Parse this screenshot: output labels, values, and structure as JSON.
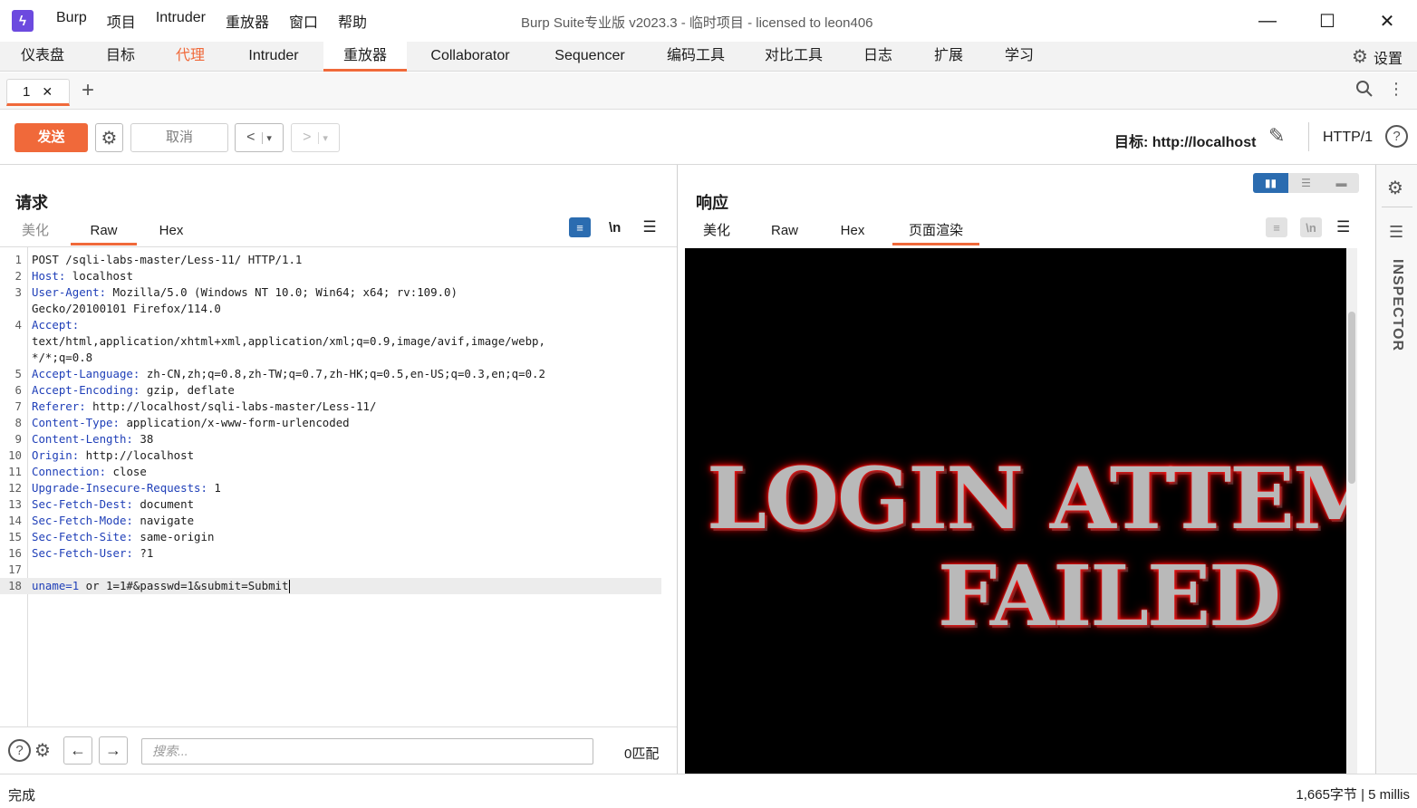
{
  "app": {
    "logo": "ϟ",
    "title": "Burp Suite专业版  v2023.3 - 临时项目 - licensed to leon406"
  },
  "menu": [
    "Burp",
    "项目",
    "Intruder",
    "重放器",
    "窗口",
    "帮助"
  ],
  "window_controls": [
    "—",
    "☐",
    "✕"
  ],
  "main_tabs": [
    "仪表盘",
    "目标",
    "代理",
    "Intruder",
    "重放器",
    "Collaborator",
    "Sequencer",
    "编码工具",
    "对比工具",
    "日志",
    "扩展",
    "学习"
  ],
  "settings_label": "设置",
  "sub_tab": {
    "label": "1",
    "close": "✕",
    "add": "+"
  },
  "toolbar": {
    "send": "发送",
    "cancel": "取消",
    "back": "<",
    "forward": ">",
    "dropdown": "▾",
    "target": "目标: http://localhost",
    "protocol": "HTTP/1",
    "help": "?"
  },
  "request": {
    "title": "请求",
    "tabs": [
      "美化",
      "Raw",
      "Hex"
    ],
    "wrap_label": "\\n",
    "menu_label": "☰",
    "lines": [
      {
        "n": "1",
        "key": "",
        "val": "POST /sqli-labs-master/Less-11/ HTTP/1.1"
      },
      {
        "n": "2",
        "key": "Host:",
        "val": " localhost"
      },
      {
        "n": "3",
        "key": "User-Agent:",
        "val": " Mozilla/5.0 (Windows NT 10.0; Win64; x64; rv:109.0)"
      },
      {
        "n": "",
        "key": "",
        "val": "Gecko/20100101 Firefox/114.0"
      },
      {
        "n": "4",
        "key": "Accept:",
        "val": ""
      },
      {
        "n": "",
        "key": "",
        "val": "text/html,application/xhtml+xml,application/xml;q=0.9,image/avif,image/webp,"
      },
      {
        "n": "",
        "key": "",
        "val": "*/*;q=0.8"
      },
      {
        "n": "5",
        "key": "Accept-Language:",
        "val": " zh-CN,zh;q=0.8,zh-TW;q=0.7,zh-HK;q=0.5,en-US;q=0.3,en;q=0.2"
      },
      {
        "n": "6",
        "key": "Accept-Encoding:",
        "val": " gzip, deflate"
      },
      {
        "n": "7",
        "key": "Referer:",
        "val": " http://localhost/sqli-labs-master/Less-11/"
      },
      {
        "n": "8",
        "key": "Content-Type:",
        "val": " application/x-www-form-urlencoded"
      },
      {
        "n": "9",
        "key": "Content-Length:",
        "val": " 38"
      },
      {
        "n": "10",
        "key": "Origin:",
        "val": " http://localhost"
      },
      {
        "n": "11",
        "key": "Connection:",
        "val": " close"
      },
      {
        "n": "12",
        "key": "Upgrade-Insecure-Requests:",
        "val": " 1"
      },
      {
        "n": "13",
        "key": "Sec-Fetch-Dest:",
        "val": " document"
      },
      {
        "n": "14",
        "key": "Sec-Fetch-Mode:",
        "val": " navigate"
      },
      {
        "n": "15",
        "key": "Sec-Fetch-Site:",
        "val": " same-origin"
      },
      {
        "n": "16",
        "key": "Sec-Fetch-User:",
        "val": " ?1"
      },
      {
        "n": "17",
        "key": "",
        "val": ""
      },
      {
        "n": "18",
        "key": "uname=1",
        "val": " or 1=1#&passwd=1&submit=Submit"
      }
    ],
    "search_placeholder": "搜索...",
    "matches": "0匹配"
  },
  "response": {
    "title": "响应",
    "tabs": [
      "美化",
      "Raw",
      "Hex",
      "页面渲染"
    ],
    "wrap_label": "\\n",
    "menu_label": "☰",
    "render_line1": "LOGIN ATTEMPT",
    "render_line2": "FAILED"
  },
  "inspector": {
    "label": "INSPECTOR"
  },
  "status": {
    "left": "完成",
    "right": "1,665字节 | 5 millis"
  },
  "colors": {
    "accent": "#f0693a",
    "keyword": "#1f3fb8",
    "toggle_on": "#2b6cb0"
  }
}
